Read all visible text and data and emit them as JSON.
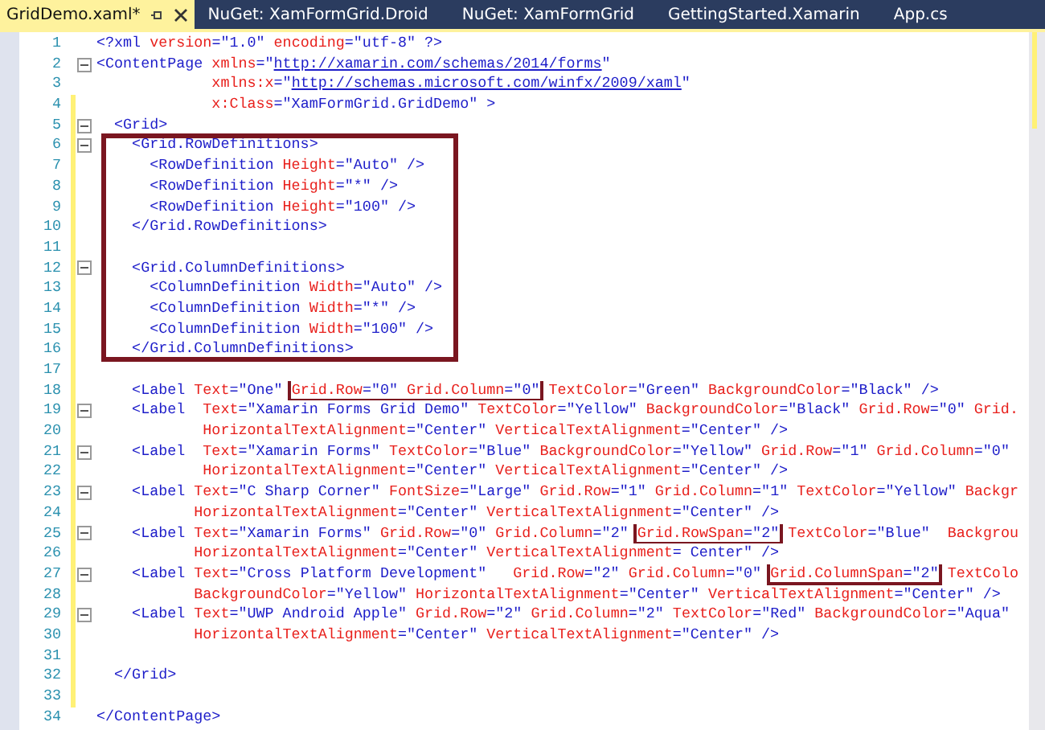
{
  "tabs": [
    {
      "label": "GridDemo.xaml*",
      "selected": true
    },
    {
      "label": "NuGet: XamFormGrid.Droid",
      "selected": false
    },
    {
      "label": "NuGet: XamFormGrid",
      "selected": false
    },
    {
      "label": "GettingStarted.Xamarin",
      "selected": false
    },
    {
      "label": "App.cs",
      "selected": false
    }
  ],
  "lines": [
    {
      "number": "1",
      "changed": false,
      "fold": false,
      "boxed": false,
      "tokens": [
        {
          "kind": "code",
          "text": "<?xml"
        },
        {
          "kind": "attr",
          "text": " version"
        },
        {
          "kind": "code",
          "text": "=\"1.0\""
        },
        {
          "kind": "attr",
          "text": " encoding"
        },
        {
          "kind": "code",
          "text": "=\"utf-8\" ?>"
        }
      ]
    },
    {
      "number": "2",
      "changed": false,
      "fold": true,
      "boxed": false,
      "tokens": [
        {
          "kind": "code",
          "text": "<ContentPage"
        },
        {
          "kind": "attr",
          "text": " xmlns"
        },
        {
          "kind": "code",
          "text": "=\""
        },
        {
          "kind": "link",
          "text": "http://xamarin.com/schemas/2014/forms"
        },
        {
          "kind": "code",
          "text": "\""
        }
      ]
    },
    {
      "number": "3",
      "changed": false,
      "fold": false,
      "boxed": false,
      "tokens": [
        {
          "kind": "attr",
          "text": "             xmlns:x"
        },
        {
          "kind": "code",
          "text": "=\""
        },
        {
          "kind": "link",
          "text": "http://schemas.microsoft.com/winfx/2009/xaml"
        },
        {
          "kind": "code",
          "text": "\""
        }
      ]
    },
    {
      "number": "4",
      "changed": true,
      "fold": false,
      "boxed": false,
      "tokens": [
        {
          "kind": "attr",
          "text": "             x:Class"
        },
        {
          "kind": "code",
          "text": "=\"XamFormGrid.GridDemo\" >"
        }
      ]
    },
    {
      "number": "5",
      "changed": true,
      "fold": true,
      "boxed": false,
      "tokens": [
        {
          "kind": "code",
          "text": "  <Grid>"
        }
      ]
    },
    {
      "number": "6",
      "changed": true,
      "fold": true,
      "boxed": true,
      "tokens": [
        {
          "kind": "code",
          "text": "    <Grid.RowDefinitions>"
        }
      ]
    },
    {
      "number": "7",
      "changed": true,
      "fold": false,
      "boxed": true,
      "tokens": [
        {
          "kind": "code",
          "text": "      <RowDefinition"
        },
        {
          "kind": "attr",
          "text": " Height"
        },
        {
          "kind": "code",
          "text": "=\"Auto\" />"
        }
      ]
    },
    {
      "number": "8",
      "changed": true,
      "fold": false,
      "boxed": true,
      "tokens": [
        {
          "kind": "code",
          "text": "      <RowDefinition"
        },
        {
          "kind": "attr",
          "text": " Height"
        },
        {
          "kind": "code",
          "text": "=\"*\" />"
        }
      ]
    },
    {
      "number": "9",
      "changed": true,
      "fold": false,
      "boxed": true,
      "tokens": [
        {
          "kind": "code",
          "text": "      <RowDefinition"
        },
        {
          "kind": "attr",
          "text": " Height"
        },
        {
          "kind": "code",
          "text": "=\"100\" />"
        }
      ]
    },
    {
      "number": "10",
      "changed": true,
      "fold": false,
      "boxed": true,
      "tokens": [
        {
          "kind": "code",
          "text": "    </Grid.RowDefinitions>"
        }
      ]
    },
    {
      "number": "11",
      "changed": true,
      "fold": false,
      "boxed": true
    },
    {
      "number": "12",
      "changed": true,
      "fold": true,
      "boxed": true,
      "tokens": [
        {
          "kind": "code",
          "text": "    <Grid.ColumnDefinitions>"
        }
      ]
    },
    {
      "number": "13",
      "changed": true,
      "fold": false,
      "boxed": true,
      "tokens": [
        {
          "kind": "code",
          "text": "      <ColumnDefinition"
        },
        {
          "kind": "attr",
          "text": " Width"
        },
        {
          "kind": "code",
          "text": "=\"Auto\" />"
        }
      ]
    },
    {
      "number": "14",
      "changed": true,
      "fold": false,
      "boxed": true,
      "tokens": [
        {
          "kind": "code",
          "text": "      <ColumnDefinition"
        },
        {
          "kind": "attr",
          "text": " Width"
        },
        {
          "kind": "code",
          "text": "=\"*\" />"
        }
      ]
    },
    {
      "number": "15",
      "changed": true,
      "fold": false,
      "boxed": true,
      "tokens": [
        {
          "kind": "code",
          "text": "      <ColumnDefinition"
        },
        {
          "kind": "attr",
          "text": " Width"
        },
        {
          "kind": "code",
          "text": "=\"100\" />"
        }
      ]
    },
    {
      "number": "16",
      "changed": true,
      "fold": false,
      "boxed": true,
      "tokens": [
        {
          "kind": "code",
          "text": "    </Grid.ColumnDefinitions>"
        }
      ]
    },
    {
      "number": "17",
      "changed": true,
      "fold": false,
      "boxed": false
    },
    {
      "number": "18",
      "changed": true,
      "fold": false,
      "boxed": false,
      "tokens": [
        {
          "kind": "code",
          "text": "    <Label"
        },
        {
          "kind": "attr",
          "text": " Text"
        },
        {
          "kind": "code",
          "text": "=\"One\" "
        },
        {
          "kind": "box",
          "children": [
            {
              "kind": "attr",
              "text": "Grid.Row"
            },
            {
              "kind": "code",
              "text": "=\"0\""
            },
            {
              "kind": "attr",
              "text": " Grid.Column"
            },
            {
              "kind": "code",
              "text": "=\"0\""
            }
          ]
        },
        {
          "kind": "attr",
          "text": " TextColor"
        },
        {
          "kind": "code",
          "text": "=\"Green\""
        },
        {
          "kind": "attr",
          "text": " BackgroundColor"
        },
        {
          "kind": "code",
          "text": "=\"Black\" />"
        }
      ]
    },
    {
      "number": "19",
      "changed": true,
      "fold": true,
      "boxed": false,
      "tokens": [
        {
          "kind": "code",
          "text": "    <Label"
        },
        {
          "kind": "attr",
          "text": "  Text"
        },
        {
          "kind": "code",
          "text": "=\"Xamarin Forms Grid Demo\""
        },
        {
          "kind": "attr",
          "text": " TextColor"
        },
        {
          "kind": "code",
          "text": "=\"Yellow\""
        },
        {
          "kind": "attr",
          "text": " BackgroundColor"
        },
        {
          "kind": "code",
          "text": "=\"Black\""
        },
        {
          "kind": "attr",
          "text": " Grid.Row"
        },
        {
          "kind": "code",
          "text": "=\"0\""
        },
        {
          "kind": "attr",
          "text": " Grid."
        }
      ]
    },
    {
      "number": "20",
      "changed": true,
      "fold": false,
      "boxed": false,
      "tokens": [
        {
          "kind": "attr",
          "text": "            HorizontalTextAlignment"
        },
        {
          "kind": "code",
          "text": "=\"Center\""
        },
        {
          "kind": "attr",
          "text": " VerticalTextAlignment"
        },
        {
          "kind": "code",
          "text": "=\"Center\" />"
        }
      ]
    },
    {
      "number": "21",
      "changed": true,
      "fold": true,
      "boxed": false,
      "tokens": [
        {
          "kind": "code",
          "text": "    <Label"
        },
        {
          "kind": "attr",
          "text": "  Text"
        },
        {
          "kind": "code",
          "text": "=\"Xamarin Forms\""
        },
        {
          "kind": "attr",
          "text": " TextColor"
        },
        {
          "kind": "code",
          "text": "=\"Blue\""
        },
        {
          "kind": "attr",
          "text": " BackgroundColor"
        },
        {
          "kind": "code",
          "text": "=\"Yellow\""
        },
        {
          "kind": "attr",
          "text": " Grid.Row"
        },
        {
          "kind": "code",
          "text": "=\"1\""
        },
        {
          "kind": "attr",
          "text": " Grid.Column"
        },
        {
          "kind": "code",
          "text": "=\"0\""
        }
      ]
    },
    {
      "number": "22",
      "changed": true,
      "fold": false,
      "boxed": false,
      "tokens": [
        {
          "kind": "attr",
          "text": "            HorizontalTextAlignment"
        },
        {
          "kind": "code",
          "text": "=\"Center\""
        },
        {
          "kind": "attr",
          "text": " VerticalTextAlignment"
        },
        {
          "kind": "code",
          "text": "=\"Center\" />"
        }
      ]
    },
    {
      "number": "23",
      "changed": true,
      "fold": true,
      "boxed": false,
      "tokens": [
        {
          "kind": "code",
          "text": "    <Label"
        },
        {
          "kind": "attr",
          "text": " Text"
        },
        {
          "kind": "code",
          "text": "=\"C Sharp Corner\""
        },
        {
          "kind": "attr",
          "text": " FontSize"
        },
        {
          "kind": "code",
          "text": "=\"Large\""
        },
        {
          "kind": "attr",
          "text": " Grid.Row"
        },
        {
          "kind": "code",
          "text": "=\"1\""
        },
        {
          "kind": "attr",
          "text": " Grid.Column"
        },
        {
          "kind": "code",
          "text": "=\"1\""
        },
        {
          "kind": "attr",
          "text": " TextColor"
        },
        {
          "kind": "code",
          "text": "=\"Yellow\""
        },
        {
          "kind": "attr",
          "text": " Backgr"
        }
      ]
    },
    {
      "number": "24",
      "changed": true,
      "fold": false,
      "boxed": false,
      "tokens": [
        {
          "kind": "attr",
          "text": "           HorizontalTextAlignment"
        },
        {
          "kind": "code",
          "text": "=\"Center\""
        },
        {
          "kind": "attr",
          "text": " VerticalTextAlignment"
        },
        {
          "kind": "code",
          "text": "=\"Center\" />"
        }
      ]
    },
    {
      "number": "25",
      "changed": true,
      "fold": true,
      "boxed": false,
      "tokens": [
        {
          "kind": "code",
          "text": "    <Label"
        },
        {
          "kind": "attr",
          "text": " Text"
        },
        {
          "kind": "code",
          "text": "=\"Xamarin Forms\""
        },
        {
          "kind": "attr",
          "text": " Grid.Row"
        },
        {
          "kind": "code",
          "text": "=\"0\""
        },
        {
          "kind": "attr",
          "text": " Grid.Column"
        },
        {
          "kind": "code",
          "text": "=\"2\" "
        },
        {
          "kind": "box",
          "children": [
            {
              "kind": "attr",
              "text": "Grid.RowSpan"
            },
            {
              "kind": "code",
              "text": "=\"2\""
            }
          ]
        },
        {
          "kind": "attr",
          "text": " TextColor"
        },
        {
          "kind": "code",
          "text": "=\"Blue\""
        },
        {
          "kind": "attr",
          "text": "  Backgrou"
        }
      ]
    },
    {
      "number": "26",
      "changed": true,
      "fold": false,
      "boxed": false,
      "tokens": [
        {
          "kind": "attr",
          "text": "           HorizontalTextAlignment"
        },
        {
          "kind": "code",
          "text": "=\"Center\""
        },
        {
          "kind": "attr",
          "text": " VerticalTextAlignment"
        },
        {
          "kind": "code",
          "text": "= Center\" />"
        }
      ]
    },
    {
      "number": "27",
      "changed": true,
      "fold": true,
      "boxed": false,
      "tokens": [
        {
          "kind": "code",
          "text": "    <Label"
        },
        {
          "kind": "attr",
          "text": " Text"
        },
        {
          "kind": "code",
          "text": "=\"Cross Platform Development\""
        },
        {
          "kind": "attr",
          "text": "   Grid.Row"
        },
        {
          "kind": "code",
          "text": "=\"2\""
        },
        {
          "kind": "attr",
          "text": " Grid.Column"
        },
        {
          "kind": "code",
          "text": "=\"0\" "
        },
        {
          "kind": "box",
          "children": [
            {
              "kind": "attr",
              "text": "Grid.ColumnSpan"
            },
            {
              "kind": "code",
              "text": "=\"2\""
            }
          ]
        },
        {
          "kind": "attr",
          "text": " TextColo"
        }
      ]
    },
    {
      "number": "28",
      "changed": true,
      "fold": false,
      "boxed": false,
      "tokens": [
        {
          "kind": "attr",
          "text": "           BackgroundColor"
        },
        {
          "kind": "code",
          "text": "=\"Yellow\""
        },
        {
          "kind": "attr",
          "text": " HorizontalTextAlignment"
        },
        {
          "kind": "code",
          "text": "=\"Center\""
        },
        {
          "kind": "attr",
          "text": " VerticalTextAlignment"
        },
        {
          "kind": "code",
          "text": "=\"Center\" />"
        }
      ]
    },
    {
      "number": "29",
      "changed": true,
      "fold": true,
      "boxed": false,
      "tokens": [
        {
          "kind": "code",
          "text": "    <Label"
        },
        {
          "kind": "attr",
          "text": " Text"
        },
        {
          "kind": "code",
          "text": "=\"UWP Android Apple\""
        },
        {
          "kind": "attr",
          "text": " Grid.Row"
        },
        {
          "kind": "code",
          "text": "=\"2\""
        },
        {
          "kind": "attr",
          "text": " Grid.Column"
        },
        {
          "kind": "code",
          "text": "=\"2\""
        },
        {
          "kind": "attr",
          "text": " TextColor"
        },
        {
          "kind": "code",
          "text": "=\"Red\""
        },
        {
          "kind": "attr",
          "text": " BackgroundColor"
        },
        {
          "kind": "code",
          "text": "=\"Aqua\""
        }
      ]
    },
    {
      "number": "30",
      "changed": true,
      "fold": false,
      "boxed": false,
      "tokens": [
        {
          "kind": "attr",
          "text": "           HorizontalTextAlignment"
        },
        {
          "kind": "code",
          "text": "=\"Center\""
        },
        {
          "kind": "attr",
          "text": " VerticalTextAlignment"
        },
        {
          "kind": "code",
          "text": "=\"Center\" />"
        }
      ]
    },
    {
      "number": "31",
      "changed": true,
      "fold": false,
      "boxed": false
    },
    {
      "number": "32",
      "changed": true,
      "fold": false,
      "boxed": false,
      "tokens": [
        {
          "kind": "code",
          "text": "  </Grid>"
        }
      ]
    },
    {
      "number": "33",
      "changed": true,
      "fold": false,
      "boxed": false
    },
    {
      "number": "34",
      "changed": false,
      "fold": false,
      "boxed": false,
      "tokens": [
        {
          "kind": "code",
          "text": "</ContentPage>"
        }
      ]
    }
  ]
}
